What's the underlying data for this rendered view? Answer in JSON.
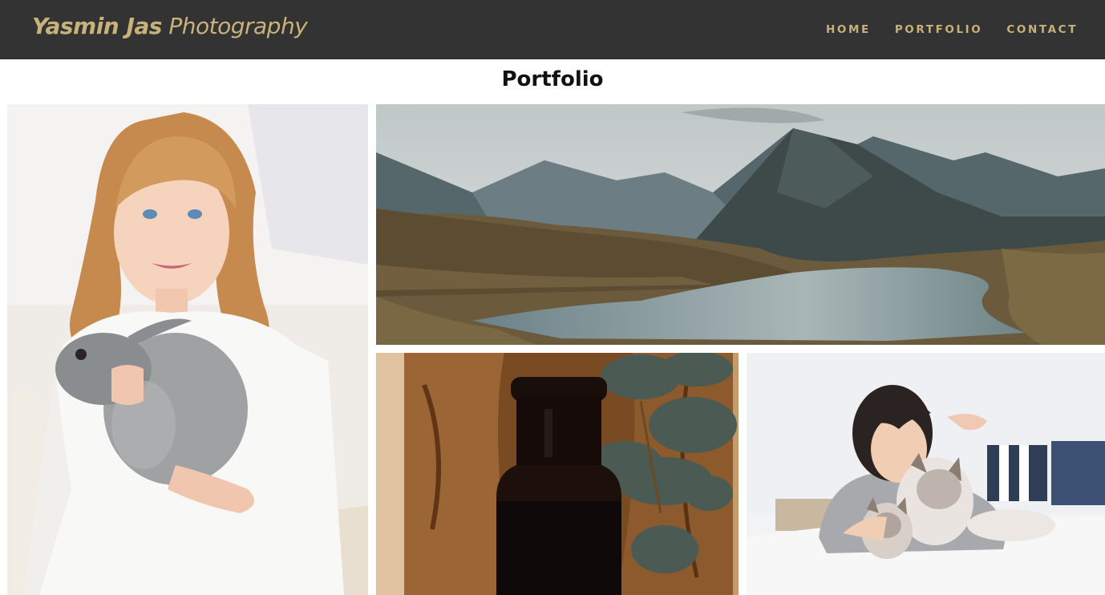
{
  "brand": {
    "name_bold": "Yasmin Jas",
    "name_rest": " Photography"
  },
  "nav": {
    "items": [
      "HOME",
      "PORTFOLIO",
      "CONTACT"
    ]
  },
  "page": {
    "title": "Portfolio"
  },
  "colors": {
    "navbar_bg": "#333333",
    "accent": "#c9b27a",
    "background": "#ffffff"
  },
  "gallery": [
    {
      "subject": "girl holding grey rabbit"
    },
    {
      "subject": "mountain lake landscape"
    },
    {
      "subject": "dark glass bottle on wooden board with eucalyptus"
    },
    {
      "subject": "woman lying on bed with cats"
    }
  ]
}
